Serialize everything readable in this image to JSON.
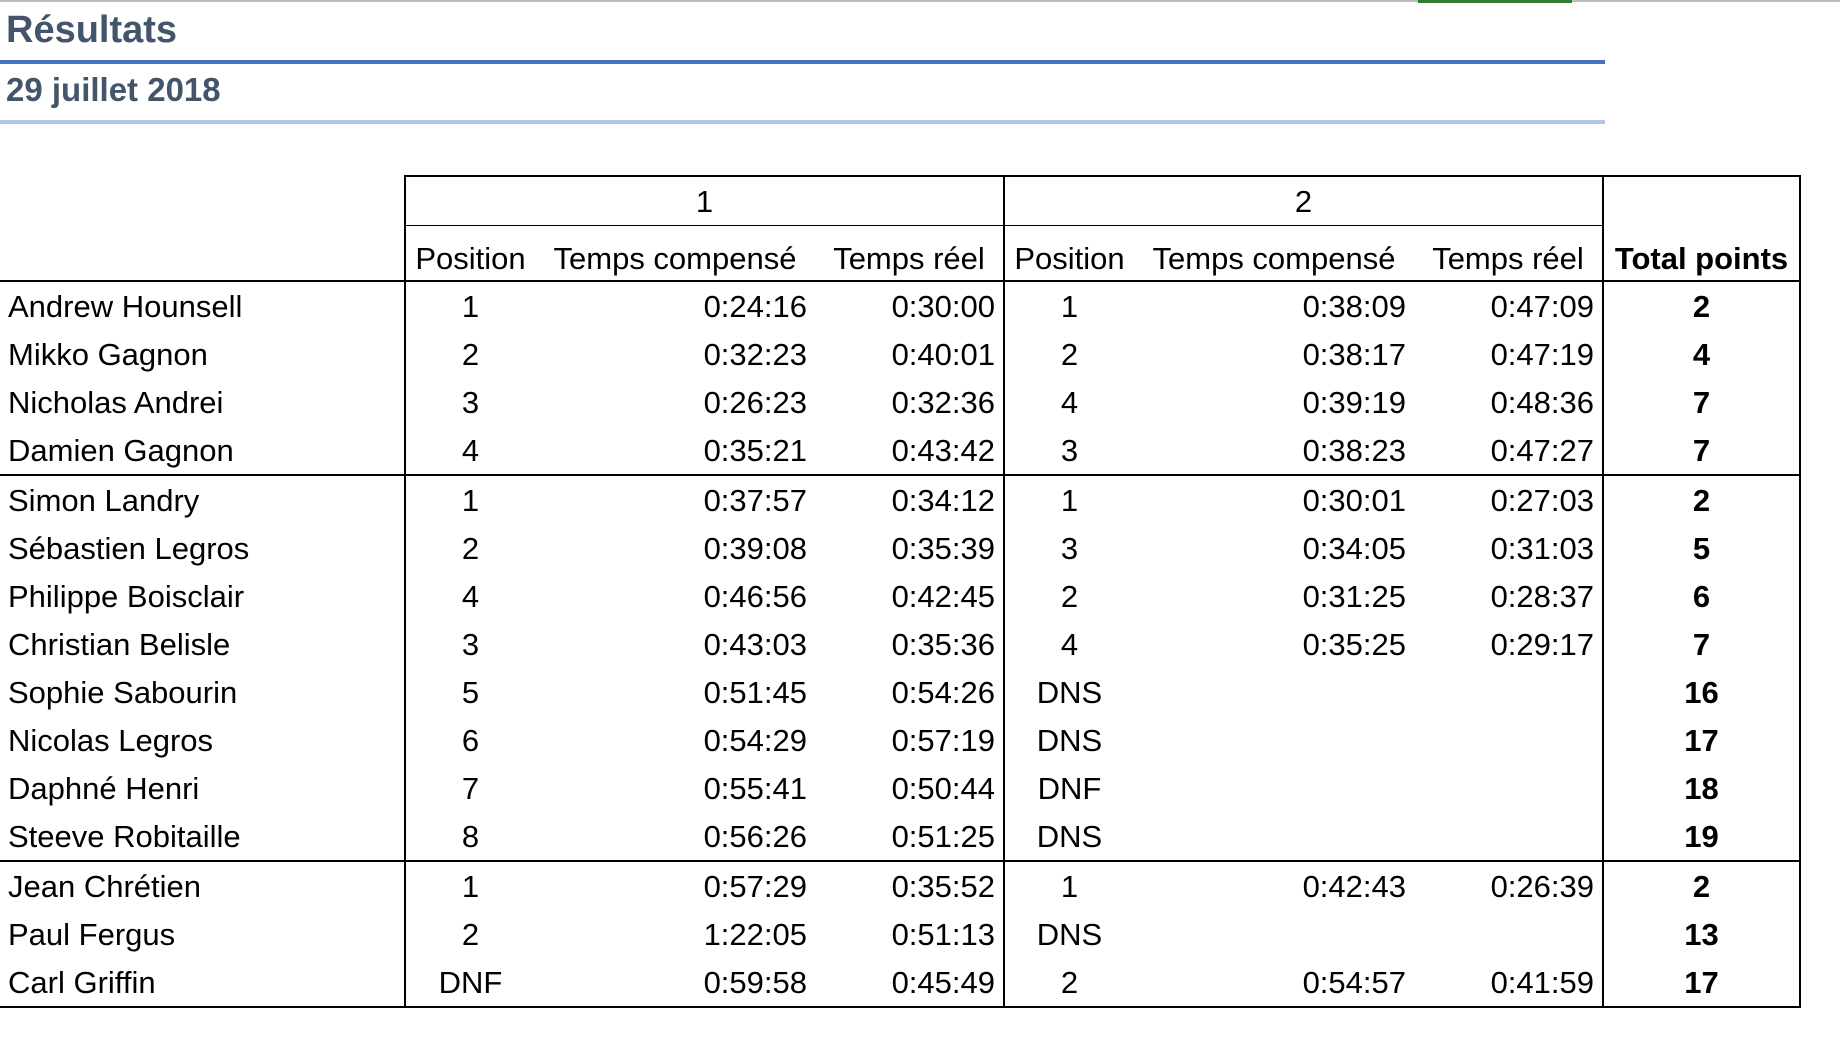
{
  "header": {
    "title": "Résultats",
    "date": "29 juillet 2018"
  },
  "table": {
    "races": [
      "1",
      "2"
    ],
    "subheaders": {
      "position": "Position",
      "compensated": "Temps compensé",
      "real": "Temps réel"
    },
    "total_header": "Total points",
    "groups": [
      [
        {
          "name": "Andrew Hounsell",
          "r1": {
            "pos": "1",
            "comp": "0:24:16",
            "real": "0:30:00"
          },
          "r2": {
            "pos": "1",
            "comp": "0:38:09",
            "real": "0:47:09"
          },
          "total": "2"
        },
        {
          "name": "Mikko Gagnon",
          "r1": {
            "pos": "2",
            "comp": "0:32:23",
            "real": "0:40:01"
          },
          "r2": {
            "pos": "2",
            "comp": "0:38:17",
            "real": "0:47:19"
          },
          "total": "4"
        },
        {
          "name": "Nicholas Andrei",
          "r1": {
            "pos": "3",
            "comp": "0:26:23",
            "real": "0:32:36"
          },
          "r2": {
            "pos": "4",
            "comp": "0:39:19",
            "real": "0:48:36"
          },
          "total": "7"
        },
        {
          "name": "Damien Gagnon",
          "r1": {
            "pos": "4",
            "comp": "0:35:21",
            "real": "0:43:42"
          },
          "r2": {
            "pos": "3",
            "comp": "0:38:23",
            "real": "0:47:27"
          },
          "total": "7"
        }
      ],
      [
        {
          "name": "Simon Landry",
          "r1": {
            "pos": "1",
            "comp": "0:37:57",
            "real": "0:34:12"
          },
          "r2": {
            "pos": "1",
            "comp": "0:30:01",
            "real": "0:27:03"
          },
          "total": "2"
        },
        {
          "name": "Sébastien Legros",
          "r1": {
            "pos": "2",
            "comp": "0:39:08",
            "real": "0:35:39"
          },
          "r2": {
            "pos": "3",
            "comp": "0:34:05",
            "real": "0:31:03"
          },
          "total": "5"
        },
        {
          "name": "Philippe Boisclair",
          "r1": {
            "pos": "4",
            "comp": "0:46:56",
            "real": "0:42:45"
          },
          "r2": {
            "pos": "2",
            "comp": "0:31:25",
            "real": "0:28:37"
          },
          "total": "6"
        },
        {
          "name": "Christian Belisle",
          "r1": {
            "pos": "3",
            "comp": "0:43:03",
            "real": "0:35:36"
          },
          "r2": {
            "pos": "4",
            "comp": "0:35:25",
            "real": "0:29:17"
          },
          "total": "7"
        },
        {
          "name": "Sophie Sabourin",
          "r1": {
            "pos": "5",
            "comp": "0:51:45",
            "real": "0:54:26"
          },
          "r2": {
            "pos": "DNS",
            "comp": "",
            "real": ""
          },
          "total": "16"
        },
        {
          "name": "Nicolas Legros",
          "r1": {
            "pos": "6",
            "comp": "0:54:29",
            "real": "0:57:19"
          },
          "r2": {
            "pos": "DNS",
            "comp": "",
            "real": ""
          },
          "total": "17"
        },
        {
          "name": "Daphné Henri",
          "r1": {
            "pos": "7",
            "comp": "0:55:41",
            "real": "0:50:44"
          },
          "r2": {
            "pos": "DNF",
            "comp": "",
            "real": ""
          },
          "total": "18"
        },
        {
          "name": "Steeve  Robitaille",
          "r1": {
            "pos": "8",
            "comp": "0:56:26",
            "real": "0:51:25"
          },
          "r2": {
            "pos": "DNS",
            "comp": "",
            "real": ""
          },
          "total": "19"
        }
      ],
      [
        {
          "name": "Jean Chrétien",
          "r1": {
            "pos": "1",
            "comp": "0:57:29",
            "real": "0:35:52"
          },
          "r2": {
            "pos": "1",
            "comp": "0:42:43",
            "real": "0:26:39"
          },
          "total": "2"
        },
        {
          "name": "Paul Fergus",
          "r1": {
            "pos": "2",
            "comp": "1:22:05",
            "real": "0:51:13"
          },
          "r2": {
            "pos": "DNS",
            "comp": "",
            "real": ""
          },
          "total": "13"
        },
        {
          "name": "Carl Griffin",
          "r1": {
            "pos": "DNF",
            "comp": "0:59:58",
            "real": "0:45:49"
          },
          "r2": {
            "pos": "2",
            "comp": "0:54:57",
            "real": "0:41:59"
          },
          "total": "17"
        }
      ]
    ]
  }
}
